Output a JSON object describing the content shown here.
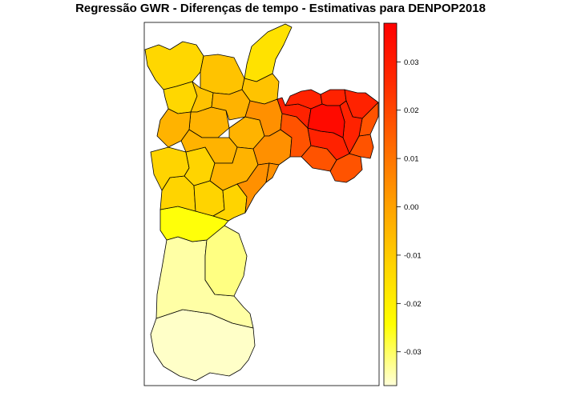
{
  "title": "Regressão GWR - Diferenças de tempo - Estimativas para DENPOP2018",
  "legend": {
    "range": [
      -0.037,
      0.038
    ],
    "ticks": [
      {
        "value": 0.03,
        "label": "0.03"
      },
      {
        "value": 0.02,
        "label": "0.02"
      },
      {
        "value": 0.01,
        "label": "0.01"
      },
      {
        "value": 0.0,
        "label": "0.00"
      },
      {
        "value": -0.01,
        "label": "-0.01"
      },
      {
        "value": -0.02,
        "label": "-0.02"
      },
      {
        "value": -0.03,
        "label": "-0.03"
      }
    ],
    "colors": [
      "#ffffd9",
      "#ffff00",
      "#ffd400",
      "#ffa000",
      "#ff6600",
      "#ff2a00",
      "#ff0000"
    ]
  },
  "regions": {
    "far_south": -0.036,
    "south_mid": -0.034,
    "south_lake": -0.032,
    "south_west_lobe": -0.025,
    "northwest": -0.013,
    "north_tip": -0.016,
    "north_center": -0.008,
    "west": -0.012,
    "center": -0.004,
    "east_inner": 0.004,
    "east": 0.017,
    "east_core": 0.028,
    "east_hotspot": 0.035
  }
}
